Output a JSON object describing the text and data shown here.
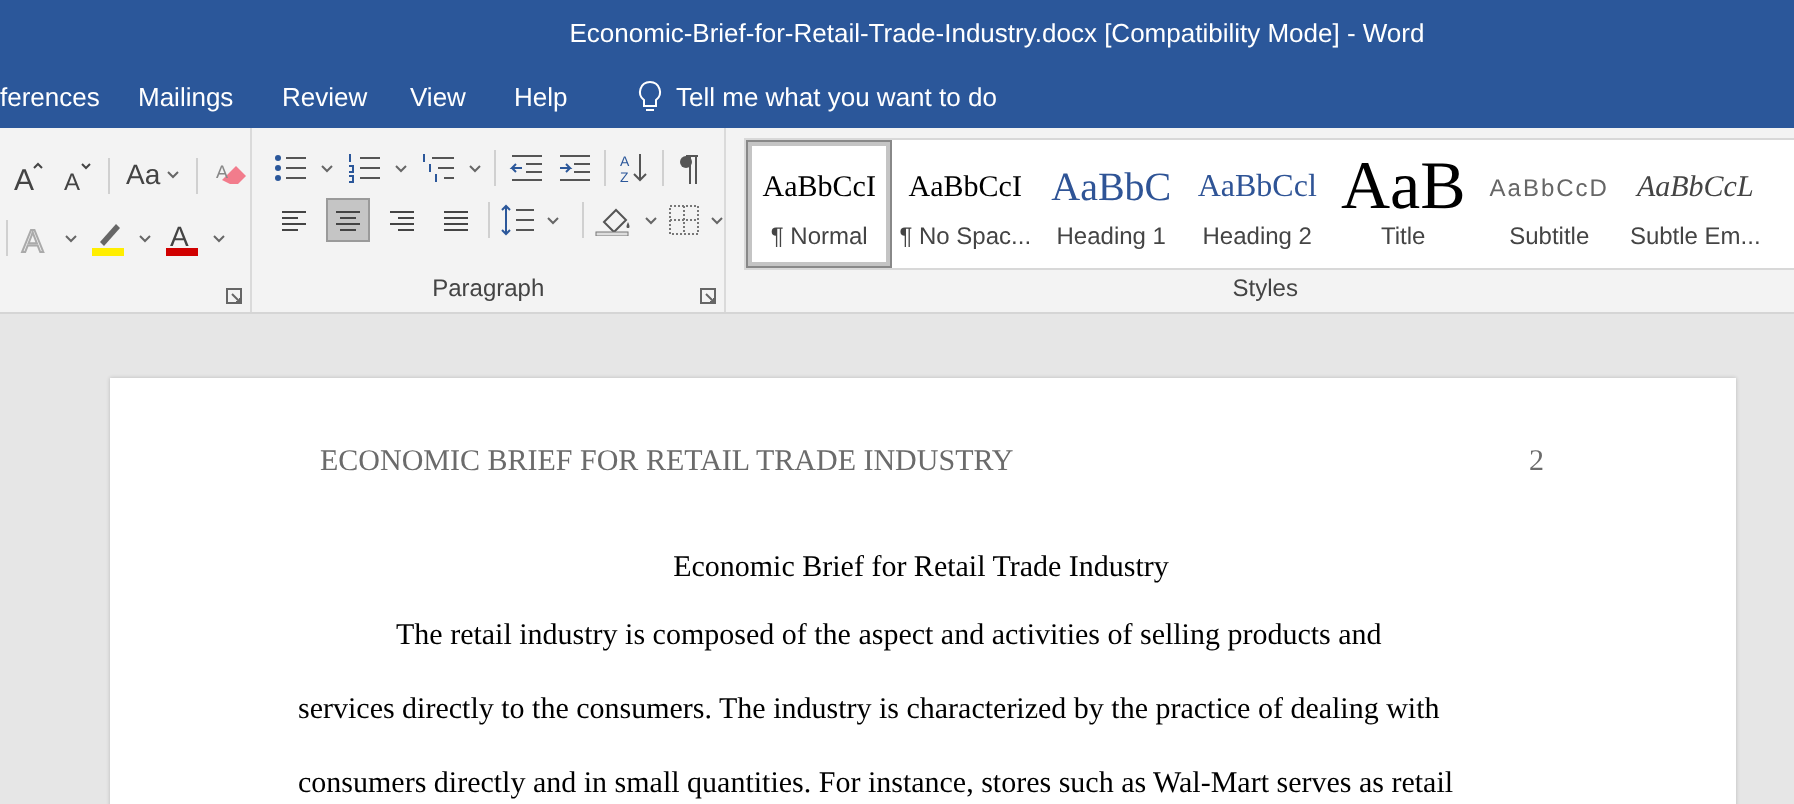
{
  "window": {
    "title": "Economic-Brief-for-Retail-Trade-Industry.docx [Compatibility Mode]  -  Word"
  },
  "tabs": [
    {
      "label": "ferences"
    },
    {
      "label": "Mailings"
    },
    {
      "label": "Review"
    },
    {
      "label": "View"
    },
    {
      "label": "Help"
    }
  ],
  "tell_me": {
    "placeholder": "Tell me what you want to do"
  },
  "font_group": {
    "case_label": "Aa",
    "grow_font": "A",
    "shrink_font": "A",
    "clear_formatting": "A",
    "text_effects": "A",
    "font_color": "A"
  },
  "sort": {
    "top": "A",
    "bottom": "Z"
  },
  "paragraph_group": {
    "label": "Paragraph",
    "alignment": [
      {
        "kind": "left",
        "selected": false
      },
      {
        "kind": "center",
        "selected": true
      },
      {
        "kind": "right",
        "selected": false
      },
      {
        "kind": "justify",
        "selected": false
      }
    ]
  },
  "styles_group": {
    "label": "Styles",
    "items": [
      {
        "kind": "normal",
        "preview": "AaBbCcI",
        "label": "¶ Normal",
        "selected": true
      },
      {
        "kind": "nospacing",
        "preview": "AaBbCcI",
        "label": "¶ No Spac...",
        "selected": false
      },
      {
        "kind": "heading1",
        "preview": "AaBbC",
        "label": "Heading 1",
        "selected": false
      },
      {
        "kind": "heading2",
        "preview": "AaBbCcl",
        "label": "Heading 2",
        "selected": false
      },
      {
        "kind": "title",
        "preview": "AaB",
        "label": "Title",
        "selected": false
      },
      {
        "kind": "subtitle",
        "preview": "AaBbCcD",
        "label": "Subtitle",
        "selected": false
      },
      {
        "kind": "emphasis",
        "preview": "AaBbCcL",
        "label": "Subtle Em...",
        "selected": false
      }
    ]
  },
  "document": {
    "header": "ECONOMIC BRIEF FOR RETAIL TRADE INDUSTRY",
    "page_number": "2",
    "title": "Economic Brief for Retail Trade Industry",
    "lines": [
      "The retail industry is composed of the aspect and activities of selling products and",
      "services directly to the consumers. The industry is characterized by the practice of dealing with",
      "consumers directly and in small quantities. For instance, stores such as Wal-Mart serves as retail"
    ]
  }
}
